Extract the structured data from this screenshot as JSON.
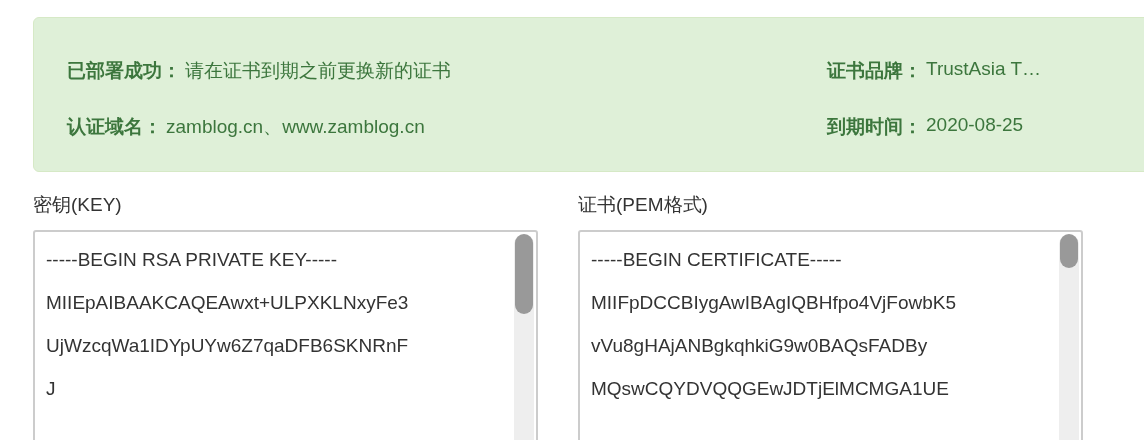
{
  "alert": {
    "rows": [
      {
        "label": "已部署成功：",
        "value": "请在证书到期之前更换新的证书"
      },
      {
        "label": "认证域名：",
        "value": "zamblog.cn、www.zamblog.cn"
      }
    ],
    "side_rows": [
      {
        "label": "证书品牌：",
        "value": "TrustAsia T…"
      },
      {
        "label": "到期时间：",
        "value": "2020-08-25"
      }
    ]
  },
  "fields": [
    {
      "label": "密钥(KEY)",
      "lines": [
        "-----BEGIN RSA PRIVATE KEY-----",
        "MIIEpAIBAAKCAQEAwxt+ULPXKLNxyFe3",
        "UjWzcqWa1IDYpUYw6Z7qaDFB6SKNRnF",
        "J"
      ]
    },
    {
      "label": "证书(PEM格式)",
      "lines": [
        "-----BEGIN CERTIFICATE-----",
        "MIIFpDCCBIygAwIBAgIQBHfpo4VjFowbK5",
        "vVu8gHAjANBgkqhkiG9w0BAQsFADBy",
        "MQswCQYDVQQGEwJDTjElMCMGA1UE"
      ]
    }
  ]
}
